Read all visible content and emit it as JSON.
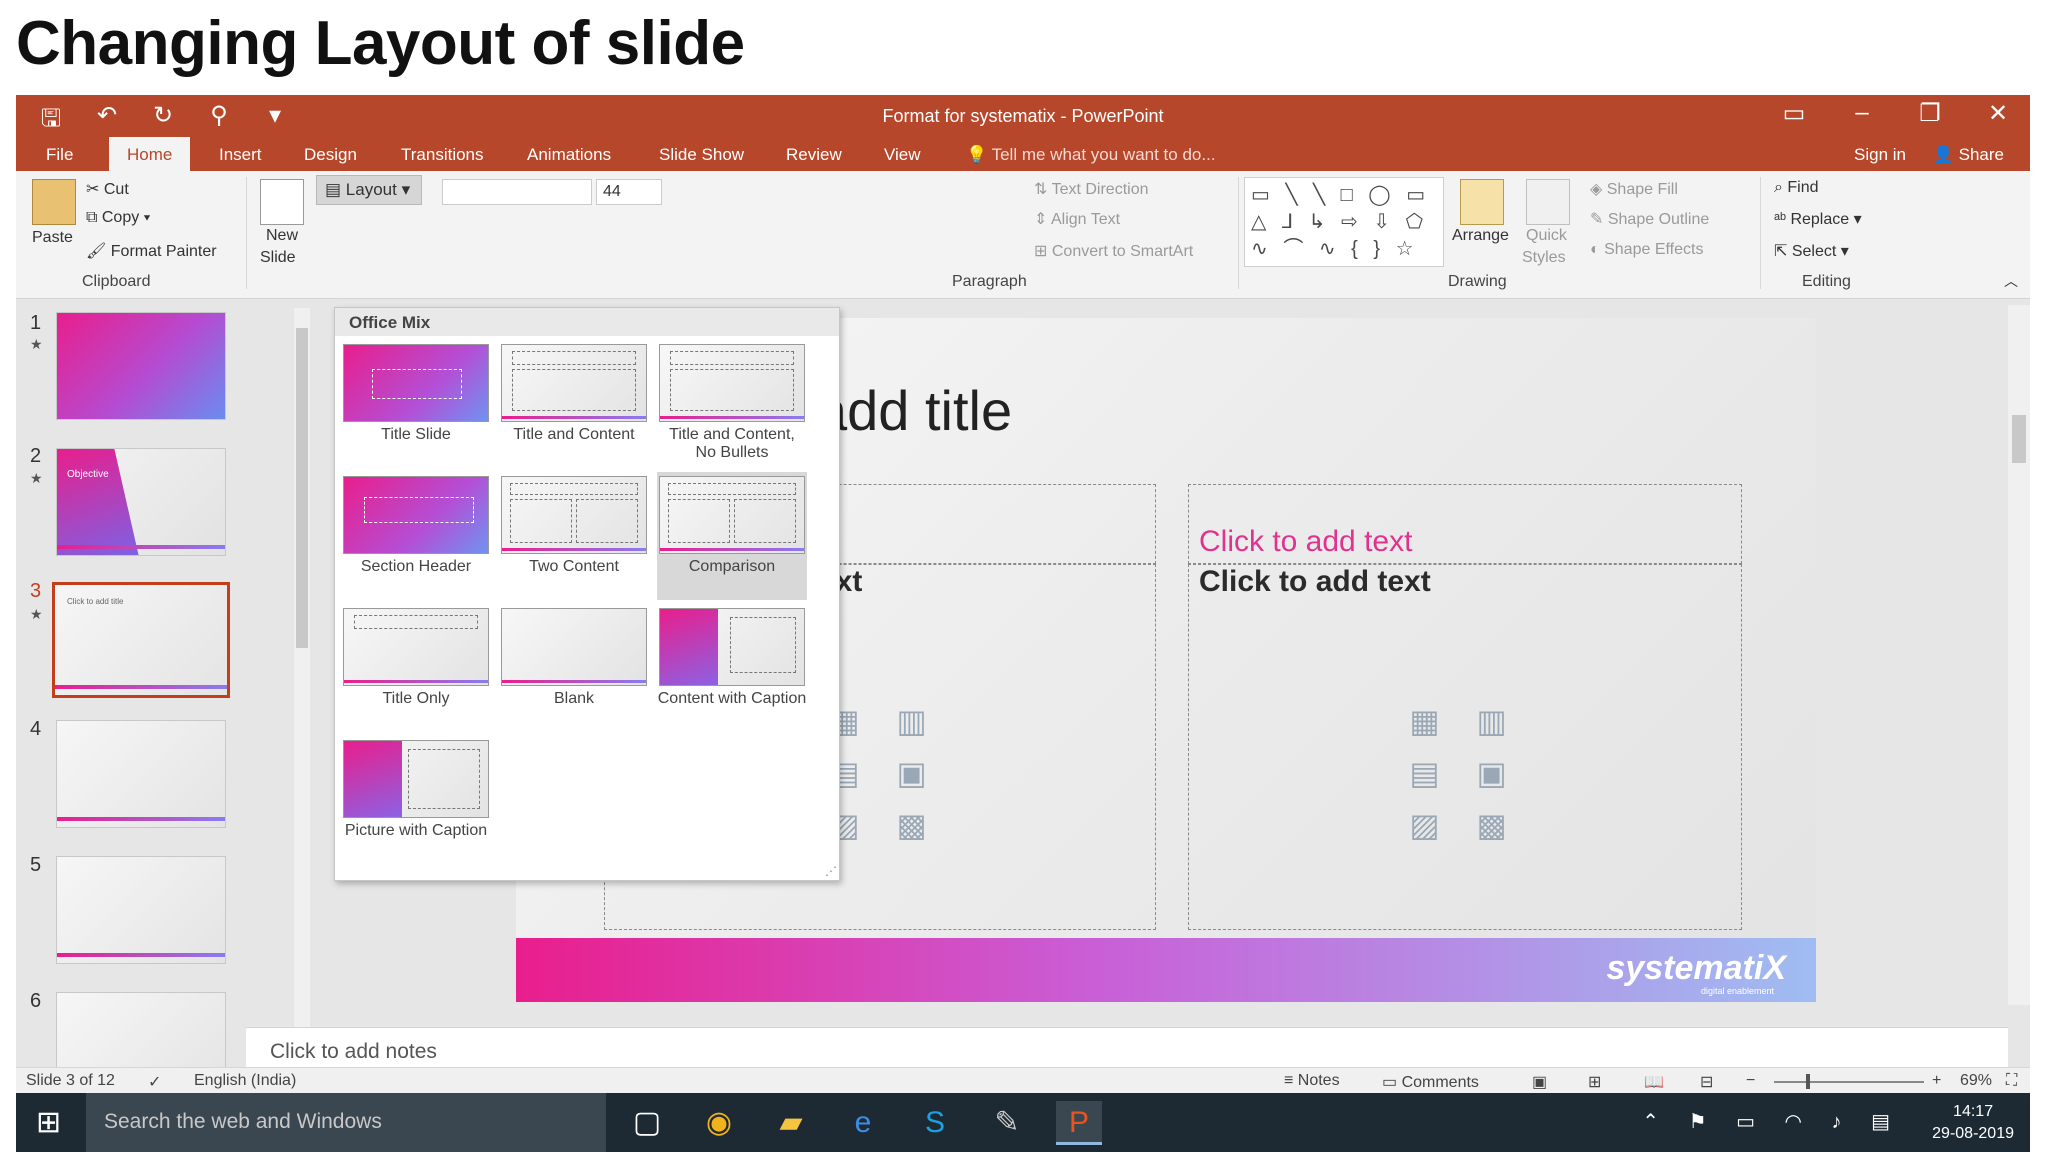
{
  "heading": "Changing Layout of  slide",
  "window": {
    "title": "Format for systematix - PowerPoint",
    "qat": {
      "save": "🖫",
      "undo": "↶",
      "redo": "↻",
      "present": "⚲",
      "customize": "▾"
    },
    "controls": {
      "ribbon_display": "▭",
      "minimize": "–",
      "restore": "❐",
      "close": "✕"
    }
  },
  "tabs": [
    "File",
    "Home",
    "Insert",
    "Design",
    "Transitions",
    "Animations",
    "Slide Show",
    "Review",
    "View"
  ],
  "active_tab": "Home",
  "tell_me": "Tell me what you want to do...",
  "sign_in": "Sign in",
  "share": "Share",
  "ribbon": {
    "clipboard": {
      "paste": "Paste",
      "cut": "Cut",
      "copy": "Copy",
      "format_painter": "Format Painter",
      "label": "Clipboard"
    },
    "slides": {
      "new_slide": "New",
      "new_slide2": "Slide",
      "layout": "Layout"
    },
    "font": {
      "size": "44"
    },
    "paragraph": {
      "label": "Paragraph",
      "text_direction": "Text Direction",
      "align_text": "Align Text",
      "convert_smartart": "Convert to SmartArt"
    },
    "drawing": {
      "label": "Drawing",
      "arrange": "Arrange",
      "quick_styles": "Quick",
      "quick_styles2": "Styles",
      "shape_fill": "Shape Fill",
      "shape_outline": "Shape Outline",
      "shape_effects": "Shape Effects",
      "shapes": "▭ ╲ ╲ □ ◯ ▭ △ ⅃ ↳ ⇨ ⇩ ⬠ ∿ ⌒ ∿ { } ☆"
    },
    "editing": {
      "label": "Editing",
      "find": "Find",
      "replace": "Replace",
      "select": "Select"
    }
  },
  "slides": [
    {
      "num": "1",
      "star": "★"
    },
    {
      "num": "2",
      "star": "★",
      "label": "Objective"
    },
    {
      "num": "3",
      "star": "★",
      "label": "Click to add title"
    },
    {
      "num": "4"
    },
    {
      "num": "5"
    },
    {
      "num": "6"
    }
  ],
  "layout_menu": {
    "header": "Office Mix",
    "items": [
      "Title Slide",
      "Title and Content",
      "Title and Content, No Bullets",
      "Section Header",
      "Two Content",
      "Comparison",
      "Title Only",
      "Blank",
      "Content with Caption",
      "Picture with Caption"
    ],
    "selected": "Comparison"
  },
  "slide": {
    "title": "add title",
    "left_heading": "xt",
    "left_body": "ext",
    "right_heading": "Click to add text",
    "right_body": "Click to add text",
    "brand": "systematiX",
    "brand_sub": "digital enablement",
    "content_icons": "▦ ▥ ▤ ▣ ▨ ▩"
  },
  "notes_placeholder": "Click to add notes",
  "status": {
    "slide_count": "Slide 3 of 12",
    "language": "English (India)",
    "notes": "Notes",
    "comments": "Comments",
    "zoom": "69%"
  },
  "taskbar": {
    "search": "Search the web and Windows",
    "time": "14:17",
    "date": "29-08-2019"
  },
  "colors": {
    "accent": "#b7472a",
    "pink": "#e0338f",
    "slide_sel": "#c43e1c"
  }
}
